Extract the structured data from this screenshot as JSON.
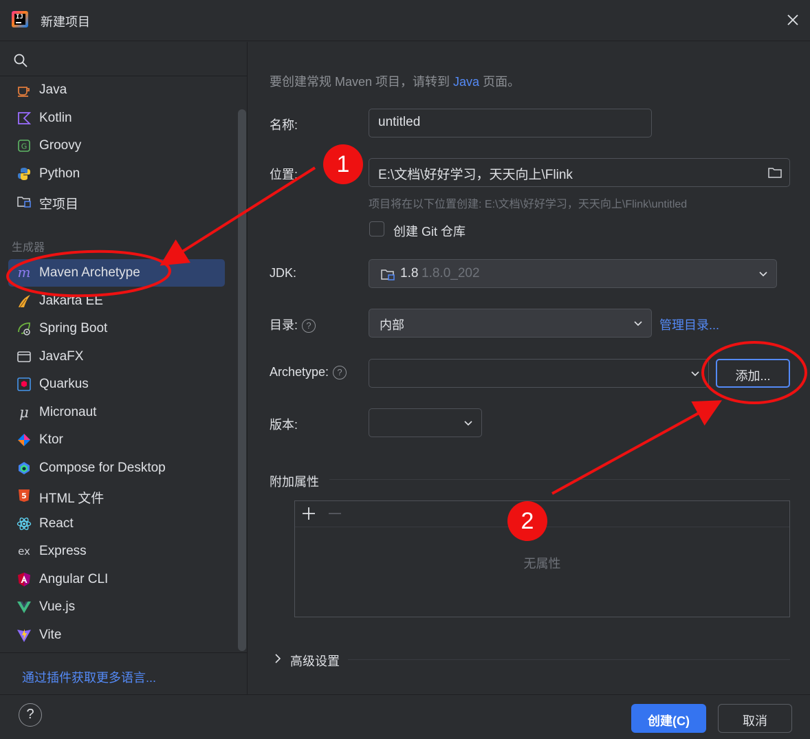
{
  "window": {
    "title": "新建项目"
  },
  "sidebar": {
    "items": [
      {
        "label": "Java",
        "icon": "java-cup-icon"
      },
      {
        "label": "Kotlin",
        "icon": "kotlin-icon"
      },
      {
        "label": "Groovy",
        "icon": "groovy-icon"
      },
      {
        "label": "Python",
        "icon": "python-icon"
      },
      {
        "label": "空项目",
        "icon": "empty-project-icon"
      }
    ],
    "section_label": "生成器",
    "generators": [
      {
        "label": "Maven Archetype",
        "icon": "maven-icon",
        "selected": true
      },
      {
        "label": "Jakarta EE",
        "icon": "jakarta-ee-icon"
      },
      {
        "label": "Spring Boot",
        "icon": "spring-boot-icon"
      },
      {
        "label": "JavaFX",
        "icon": "javafx-icon"
      },
      {
        "label": "Quarkus",
        "icon": "quarkus-icon"
      },
      {
        "label": "Micronaut",
        "icon": "micronaut-icon"
      },
      {
        "label": "Ktor",
        "icon": "ktor-icon"
      },
      {
        "label": "Compose for Desktop",
        "icon": "compose-icon"
      },
      {
        "label": "HTML 文件",
        "icon": "html5-icon"
      },
      {
        "label": "React",
        "icon": "react-icon"
      },
      {
        "label": "Express",
        "icon": "express-icon"
      },
      {
        "label": "Angular CLI",
        "icon": "angular-icon"
      },
      {
        "label": "Vue.js",
        "icon": "vue-icon"
      },
      {
        "label": "Vite",
        "icon": "vite-icon"
      }
    ],
    "more_link": "通过插件获取更多语言..."
  },
  "form": {
    "hint_prefix": "要创建常规 Maven 项目，请转到",
    "hint_link": "Java",
    "hint_suffix": "页面。",
    "name_label": "名称:",
    "name_value": "untitled",
    "location_label": "位置:",
    "location_value": "E:\\文档\\好好学习，天天向上\\Flink",
    "location_hint": "项目将在以下位置创建: E:\\文档\\好好学习，天天向上\\Flink\\untitled",
    "git_label": "创建 Git 仓库",
    "git_checked": false,
    "jdk_label": "JDK:",
    "jdk_name": "1.8",
    "jdk_version": "1.8.0_202",
    "catalog_label": "目录:",
    "catalog_value": "内部",
    "manage_catalog_link": "管理目录...",
    "archetype_label": "Archetype:",
    "archetype_value": "",
    "add_button": "添加...",
    "version_label": "版本:",
    "version_value": "",
    "extra_props_title": "附加属性",
    "props_empty": "无属性",
    "advanced_label": "高级设置"
  },
  "footer": {
    "help": "?",
    "create_button": "创建(C)",
    "cancel_button": "取消"
  },
  "annotations": {
    "badge_1": "1",
    "badge_2": "2",
    "color": "#ee1111"
  },
  "colors": {
    "background": "#2b2d30",
    "accent": "#3574f0",
    "link": "#548af7",
    "selection": "#2e436e"
  }
}
